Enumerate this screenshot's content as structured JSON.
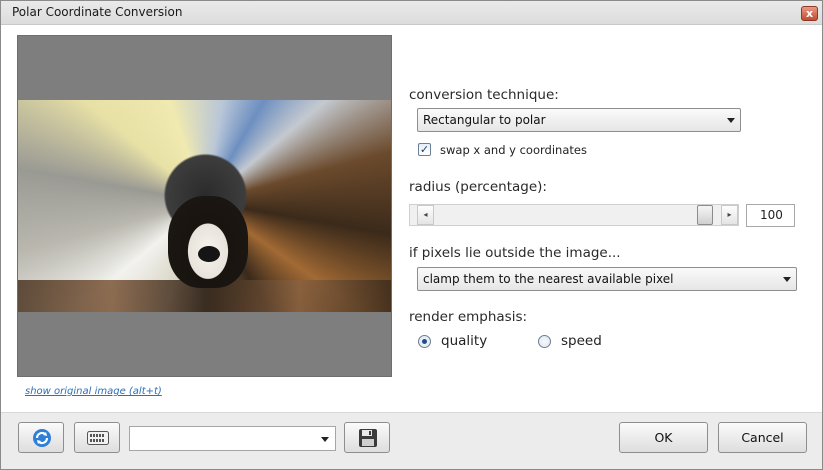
{
  "window": {
    "title": "Polar Coordinate Conversion",
    "close_glyph": "x"
  },
  "preview": {
    "show_original_link": "show original image (alt+t)"
  },
  "options": {
    "conversion_heading": "conversion technique:",
    "conversion_value": "Rectangular to polar",
    "swap_label": "swap x and y coordinates",
    "swap_checked": true,
    "check_glyph": "✓",
    "radius_heading": "radius (percentage):",
    "radius_value": "100",
    "radius_level": 1.0,
    "left_arrow": "◂",
    "right_arrow": "▸",
    "outside_heading": "if pixels lie outside the image...",
    "outside_value": "clamp them to the nearest available pixel",
    "render_heading": "render emphasis:",
    "render_options": [
      {
        "label": "quality",
        "checked": true
      },
      {
        "label": "speed",
        "checked": false
      }
    ]
  },
  "footer": {
    "ok_label": "OK",
    "cancel_label": "Cancel",
    "preset_value": ""
  },
  "icons": {
    "refresh": "refresh-icon",
    "randomize": "keyboard-icon",
    "save_preset": "save-icon"
  }
}
